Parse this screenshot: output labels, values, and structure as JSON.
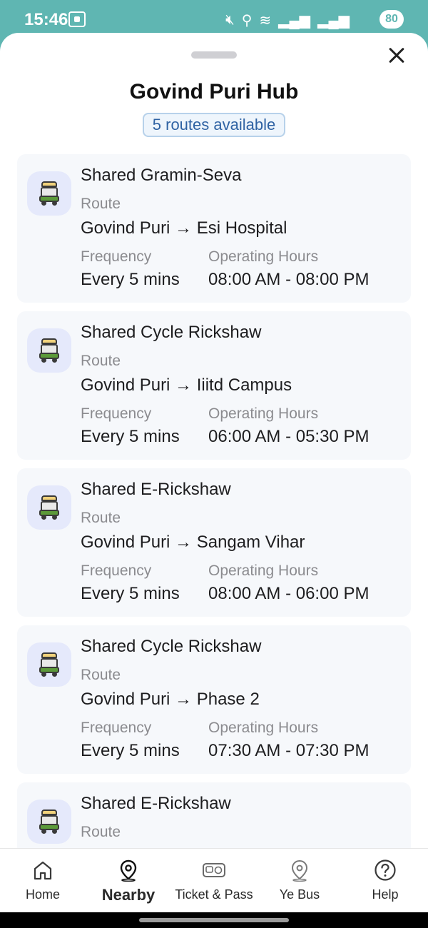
{
  "status_bar": {
    "time": "15:46",
    "battery": "80",
    "icons": [
      "screenshot-icon",
      "mute-icon",
      "location-icon",
      "wifi-icon",
      "signal-icon",
      "signal-icon"
    ]
  },
  "sheet": {
    "title": "Govind Puri Hub",
    "routes_badge": "5 routes available"
  },
  "labels": {
    "route": "Route",
    "frequency": "Frequency",
    "operating_hours": "Operating Hours"
  },
  "routes": [
    {
      "name": "Shared Gramin-Seva",
      "route_label": "Route",
      "route": "Govind Puri → Esi Hospital",
      "frequency_label": "Frequency",
      "frequency": "Every 5 mins",
      "hours_label": "Operating Hours",
      "hours": "08:00 AM - 08:00 PM"
    },
    {
      "name": "Shared Cycle Rickshaw",
      "route_label": "Route",
      "route": "Govind Puri → Iiitd Campus",
      "frequency_label": "Frequency",
      "frequency": "Every 5 mins",
      "hours_label": "Operating Hours",
      "hours": "06:00 AM - 05:30 PM"
    },
    {
      "name": "Shared E-Rickshaw",
      "route_label": "Route",
      "route": "Govind Puri → Sangam Vihar",
      "frequency_label": "Frequency",
      "frequency": "Every 5 mins",
      "hours_label": "Operating Hours",
      "hours": "08:00 AM - 06:00 PM"
    },
    {
      "name": "Shared Cycle Rickshaw",
      "route_label": "Route",
      "route": "Govind Puri → Phase 2",
      "frequency_label": "Frequency",
      "frequency": "Every 5 mins",
      "hours_label": "Operating Hours",
      "hours": "07:30 AM - 07:30 PM"
    },
    {
      "name": "Shared E-Rickshaw",
      "route_label": "Route"
    }
  ],
  "bottom_nav": {
    "items": [
      {
        "label": "Home",
        "icon": "home-icon"
      },
      {
        "label": "Nearby",
        "icon": "location-pin-icon",
        "active": true
      },
      {
        "label": "Ticket & Pass",
        "icon": "ticket-icon"
      },
      {
        "label": "Ye Bus",
        "icon": "bus-stop-icon"
      },
      {
        "label": "Help",
        "icon": "help-icon"
      }
    ]
  },
  "colors": {
    "status_bar": "#5fb6b2",
    "badge_text": "#2f62a3",
    "badge_border": "#b7d1ea",
    "card_bg": "#f6f8fb",
    "icon_bg": "#e5e9fb"
  }
}
